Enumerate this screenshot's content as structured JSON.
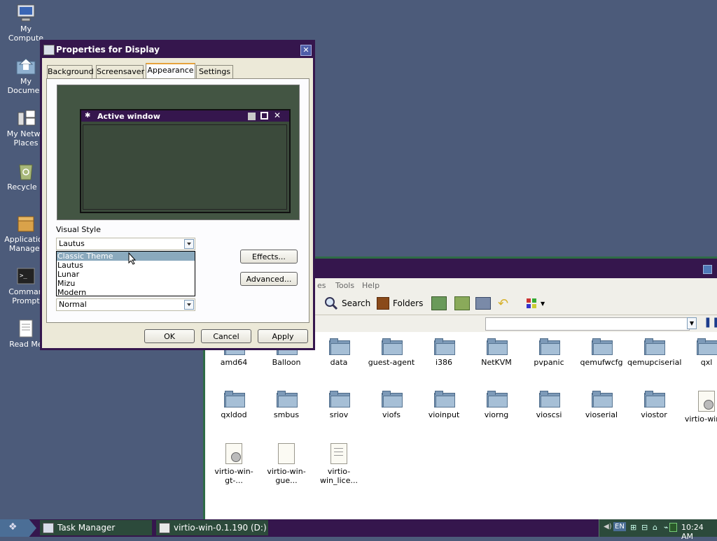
{
  "desktop": {
    "icons": [
      {
        "label_1": "My",
        "label_2": "Compute",
        "icon": "computer-icon"
      },
      {
        "label_1": "My",
        "label_2": "Documen",
        "icon": "folder-home-icon"
      },
      {
        "label_1": "My Netwo",
        "label_2": "Places",
        "icon": "network-icon"
      },
      {
        "label_1": "Recycle B",
        "label_2": "",
        "icon": "recycle-bin-icon"
      },
      {
        "label_1": "Application",
        "label_2": "Manager",
        "icon": "package-icon"
      },
      {
        "label_1": "Comman",
        "label_2": "Prompt",
        "icon": "terminal-icon"
      },
      {
        "label_1": "Read Me",
        "label_2": "",
        "icon": "document-icon"
      }
    ]
  },
  "dialog": {
    "title": "Properties for Display",
    "tabs": [
      "Background",
      "Screensaver",
      "Appearance",
      "Settings"
    ],
    "active_tab": "Appearance",
    "preview": {
      "window_title": "Active window"
    },
    "visual_style_label": "Visual Style",
    "visual_style_value": "Lautus",
    "dropdown_options": [
      "Classic Theme",
      "Lautus",
      "Lunar",
      "Mizu",
      "Modern"
    ],
    "highlighted_option": "Classic Theme",
    "font_size_value": "Normal",
    "effects_button": "Effects...",
    "advanced_button": "Advanced...",
    "ok_button": "OK",
    "cancel_button": "Cancel",
    "apply_button": "Apply"
  },
  "explorer": {
    "menus": [
      "es",
      "Tools",
      "Help"
    ],
    "search_button": "Search",
    "folders_button": "Folders",
    "items": [
      {
        "name": "amd64",
        "type": "folder"
      },
      {
        "name": "Balloon",
        "type": "folder"
      },
      {
        "name": "data",
        "type": "folder"
      },
      {
        "name": "guest-agent",
        "type": "folder"
      },
      {
        "name": "i386",
        "type": "folder"
      },
      {
        "name": "NetKVM",
        "type": "folder"
      },
      {
        "name": "pvpanic",
        "type": "folder"
      },
      {
        "name": "qemufwcfg",
        "type": "folder"
      },
      {
        "name": "qemupciserial",
        "type": "folder"
      },
      {
        "name": "qxl",
        "type": "folder"
      },
      {
        "name": "qxldod",
        "type": "folder"
      },
      {
        "name": "smbus",
        "type": "folder"
      },
      {
        "name": "sriov",
        "type": "folder"
      },
      {
        "name": "viofs",
        "type": "folder"
      },
      {
        "name": "vioinput",
        "type": "folder"
      },
      {
        "name": "viorng",
        "type": "folder"
      },
      {
        "name": "vioscsi",
        "type": "folder"
      },
      {
        "name": "vioserial",
        "type": "folder"
      },
      {
        "name": "viostor",
        "type": "folder"
      },
      {
        "name": "virtio-win-g",
        "type": "installer"
      },
      {
        "name": "virtio-win-gt-...",
        "type": "installer"
      },
      {
        "name": "virtio-win-gue...",
        "type": "file"
      },
      {
        "name": "virtio-win_lice...",
        "type": "textfile"
      }
    ]
  },
  "taskbar": {
    "items": [
      "Task Manager",
      "virtio-win-0.1.190 (D:)"
    ],
    "language": "EN",
    "clock": "10:24 AM"
  },
  "colors": {
    "titlebar": "#35164d",
    "accent_green": "#2e6b46",
    "desktop": "#4c5b7a",
    "preview_bg": "#435543"
  }
}
